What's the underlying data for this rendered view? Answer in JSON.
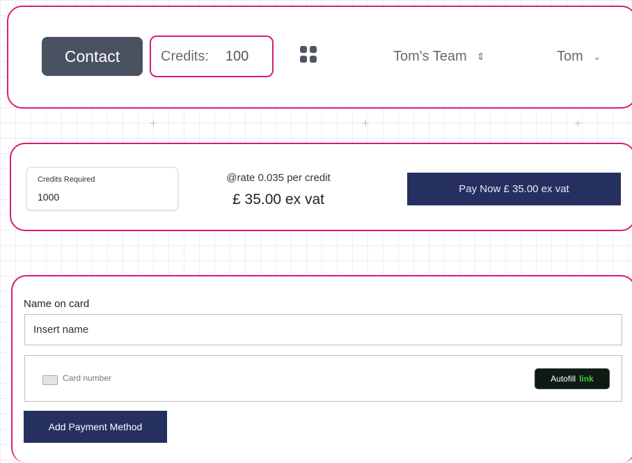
{
  "header": {
    "contact_label": "Contact",
    "credits_label": "Credits:",
    "credits_value": "100",
    "apps_icon": "grid-icon",
    "team_name": "Tom's Team",
    "team_icon": "chevron-up-down-icon",
    "user_name": "Tom",
    "user_icon": "chevron-down-icon"
  },
  "purchase": {
    "credits_required_label": "Credits Required",
    "credits_required_value": "1000",
    "rate_text": "@rate 0.035 per credit",
    "price_text": "£ 35.00 ex vat",
    "pay_button_label": "Pay Now £ 35.00 ex vat"
  },
  "payment": {
    "name_label": "Name on card",
    "name_placeholder": "Insert name",
    "card_placeholder": "Card number",
    "card_icon": "credit-card-icon",
    "autofill_label": "Autofill",
    "autofill_link": "link",
    "add_button_label": "Add Payment Method"
  },
  "colors": {
    "highlight_border": "#d81b7a",
    "primary_button": "#253060",
    "contact_button": "#4a5160",
    "link_green": "#34d13e"
  }
}
